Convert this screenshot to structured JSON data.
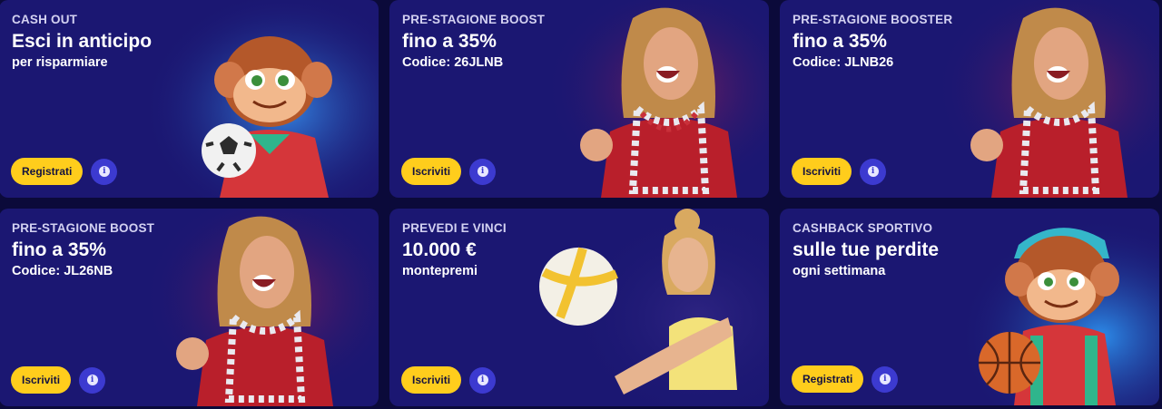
{
  "promos": [
    {
      "kicker": "CASH OUT",
      "headline": "Esci in anticipo",
      "sub": "per risparmiare",
      "button": "Registrati",
      "art": "monkey-soccer-illustration"
    },
    {
      "kicker": "PRE-STAGIONE BOOST",
      "headline": "fino a 35%",
      "sub": "Codice: 26JLNB",
      "button": "Iscriviti",
      "art": "cheering-fan-photo"
    },
    {
      "kicker": "PRE-STAGIONE BOOSTER",
      "headline": "fino a 35%",
      "sub": "Codice: JLNB26",
      "button": "Iscriviti",
      "art": "cheering-fan-photo"
    },
    {
      "kicker": "PRE-STAGIONE BOOST",
      "headline": "fino a 35%",
      "sub": "Codice: JL26NB",
      "button": "Iscriviti",
      "art": "cheering-fan-photo"
    },
    {
      "kicker": "PREVEDI E VINCI",
      "headline": "10.000 €",
      "sub": "montepremi",
      "button": "Iscriviti",
      "art": "volleyball-player-photo"
    },
    {
      "kicker": "CASHBACK SPORTIVO",
      "headline": "sulle tue perdite",
      "sub": "ogni settimana",
      "button": "Registrati",
      "art": "monkey-basketball-illustration"
    }
  ],
  "info_icon": "i",
  "colors": {
    "card_bg": "#1b1772",
    "button": "#ffcd1c",
    "info_button": "#3c3ad0",
    "page_bg": "#0b0a3a"
  }
}
